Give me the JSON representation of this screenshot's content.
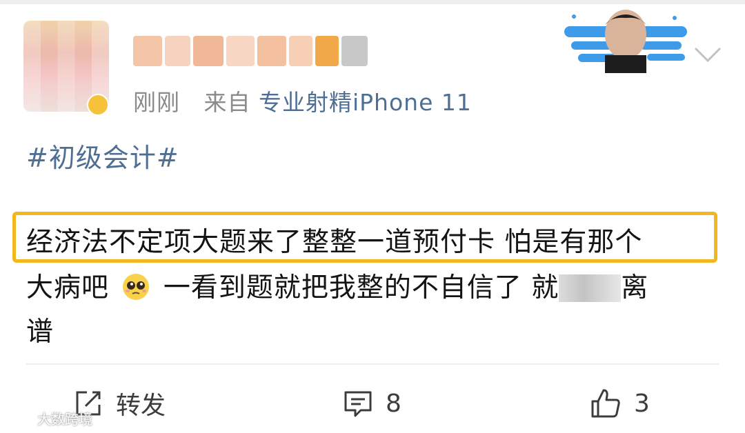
{
  "post": {
    "time": "刚刚",
    "source_prefix": "来自",
    "source": "专业射精iPhone 11",
    "topic": "#初级会计#",
    "body": {
      "line1": "经济法不定项大题来了整整一道预付卡 怕是有那个",
      "line2_before": "大病吧",
      "line2_after": "一看到题就把我整的不自信了 就",
      "line2_end": "离",
      "line3": "谱"
    }
  },
  "actions": {
    "repost_label": "转发",
    "comment_count": "8",
    "like_count": "3"
  },
  "watermark": "大数跨境",
  "colors": {
    "link": "#4f6e93",
    "highlight": "#f2b61f",
    "meta": "#8a8a8a"
  },
  "icons": [
    "repost-icon",
    "comment-icon",
    "like-icon",
    "chevron-down-icon",
    "pleading-emoji-icon"
  ]
}
